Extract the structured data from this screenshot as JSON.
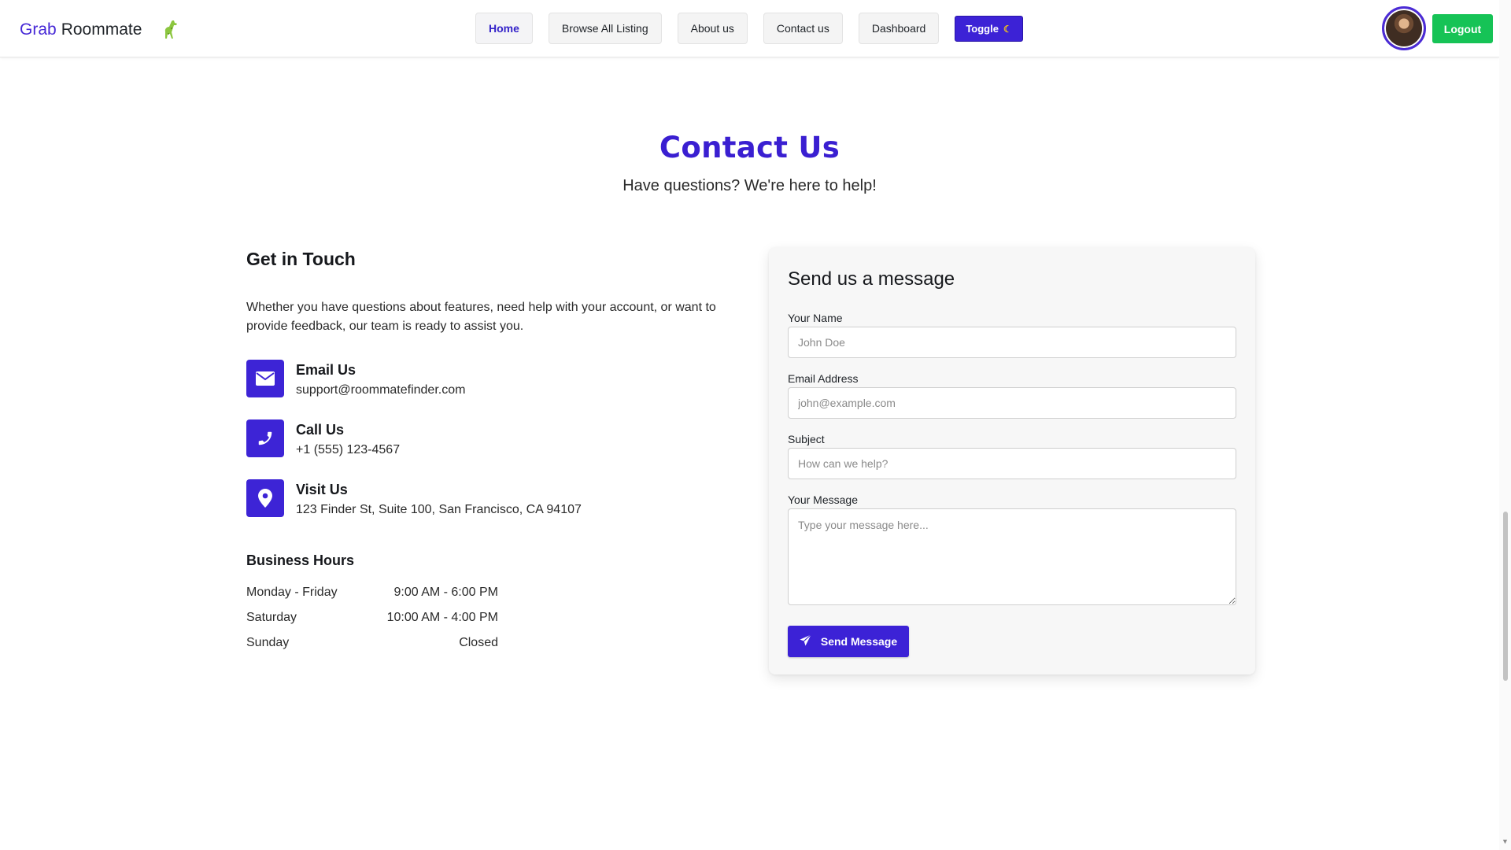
{
  "navbar": {
    "brand_part1": "Grab",
    "brand_part2": "Roommate",
    "links": [
      {
        "label": "Home",
        "active": true
      },
      {
        "label": "Browse All Listing",
        "active": false
      },
      {
        "label": "About us",
        "active": false
      },
      {
        "label": "Contact us",
        "active": false
      },
      {
        "label": "Dashboard",
        "active": false
      }
    ],
    "toggle_label": "Toggle",
    "toggle_icon": "moon-icon",
    "logout_label": "Logout"
  },
  "hero": {
    "title": "Contact Us",
    "subtitle": "Have questions? We're here to help!"
  },
  "get_in_touch": {
    "heading": "Get in Touch",
    "intro": "Whether you have questions about features, need help with your account, or want to provide feedback, our team is ready to assist you.",
    "items": [
      {
        "icon": "envelope-icon",
        "title": "Email Us",
        "value": "support@roommatefinder.com"
      },
      {
        "icon": "phone-icon",
        "title": "Call Us",
        "value": "+1 (555) 123-4567"
      },
      {
        "icon": "map-pin-icon",
        "title": "Visit Us",
        "value": "123 Finder St, Suite 100, San Francisco, CA 94107"
      }
    ],
    "hours_heading": "Business Hours",
    "hours": [
      {
        "day": "Monday - Friday",
        "time": "9:00 AM - 6:00 PM"
      },
      {
        "day": "Saturday",
        "time": "10:00 AM - 4:00 PM"
      },
      {
        "day": "Sunday",
        "time": "Closed"
      }
    ]
  },
  "form": {
    "heading": "Send us a message",
    "name_label": "Your Name",
    "name_placeholder": "John Doe",
    "email_label": "Email Address",
    "email_placeholder": "john@example.com",
    "subject_label": "Subject",
    "subject_placeholder": "How can we help?",
    "message_label": "Your Message",
    "message_placeholder": "Type your message here...",
    "submit_label": "Send Message"
  },
  "colors": {
    "primary": "#3c22d6",
    "success": "#16c356"
  }
}
